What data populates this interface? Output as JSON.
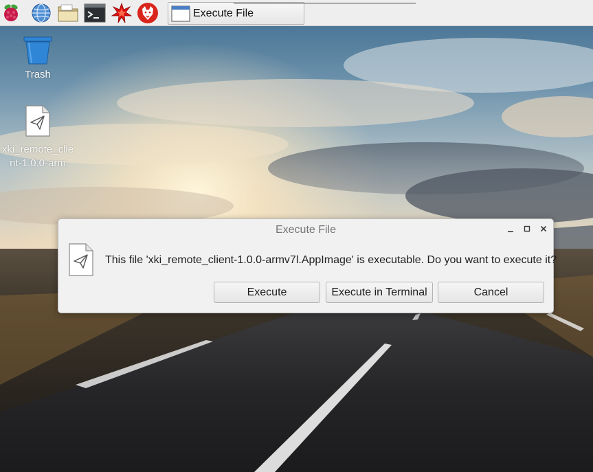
{
  "taskbar": {
    "window_label": "Execute File"
  },
  "desktop": {
    "icons": [
      {
        "label": "Trash"
      },
      {
        "label": "xki_remote_client-1.0.0-arm"
      }
    ]
  },
  "dialog": {
    "title": "Execute File",
    "message": "This file 'xki_remote_client-1.0.0-armv7l.AppImage' is executable. Do you want to execute it?",
    "buttons": {
      "execute": "Execute",
      "execute_in_terminal": "Execute in Terminal",
      "cancel": "Cancel"
    },
    "controls": {
      "minimize": "_",
      "maximize": "□",
      "close": "×"
    }
  },
  "icons": {
    "menu": "raspberry-icon",
    "browser": "globe-icon",
    "files": "folder-icon",
    "terminal": "terminal-icon",
    "mathematica": "mathematica-icon",
    "wolfram": "wolfram-icon",
    "trash": "trash-icon",
    "file": "document-send-icon"
  },
  "colors": {
    "panel_bg": "#eeeeee",
    "dialog_bg": "#f1f1f1",
    "trash_blue": "#2f86d6",
    "raspberry_red": "#c51a4a",
    "mathematica_red": "#dd1111"
  }
}
